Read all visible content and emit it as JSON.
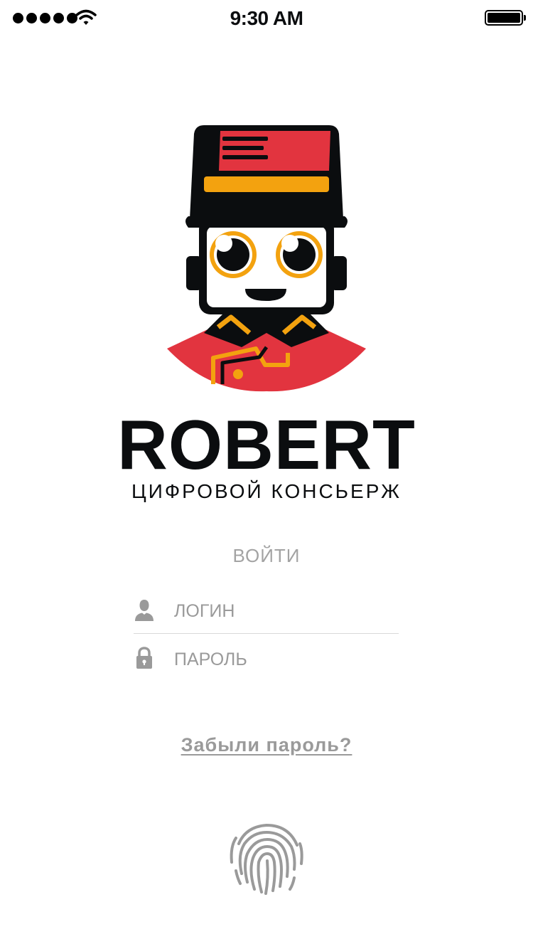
{
  "status_bar": {
    "time": "9:30 AM",
    "signal_icon": "cellular-signal-icon",
    "wifi_icon": "wifi-icon",
    "battery_icon": "battery-icon",
    "battery_level": 1.0
  },
  "brand": {
    "name": "ROBERT",
    "tagline": "ЦИФРОВОЙ КОНСЬЕРЖ",
    "logo_icon": "bellhop-robot-logo",
    "colors": {
      "black": "#0b0d0f",
      "red": "#e2343f",
      "yellow": "#f3a20f"
    }
  },
  "login": {
    "heading": "ВОЙТИ",
    "username": {
      "placeholder": "ЛОГИН",
      "value": "",
      "icon": "user-icon"
    },
    "password": {
      "placeholder": "ПАРОЛЬ",
      "value": "",
      "icon": "lock-icon"
    },
    "forgot_password": "Забыли пароль?",
    "fingerprint_icon": "fingerprint-icon"
  },
  "colors": {
    "muted_text": "#9a9a9a",
    "divider": "#d9d9d9"
  }
}
